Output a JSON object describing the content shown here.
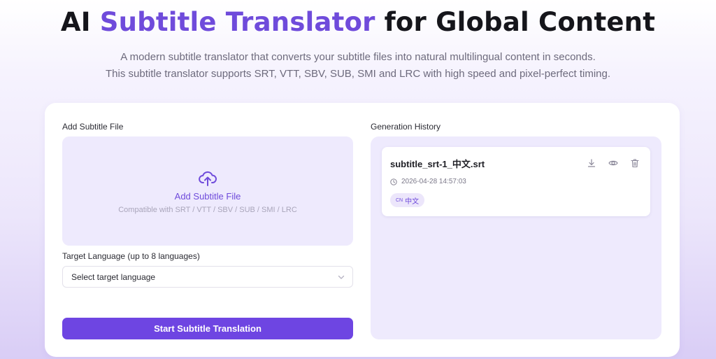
{
  "header": {
    "title_before": "AI ",
    "title_accent": "Subtitle Translator",
    "title_after": " for Global Content",
    "subtitle_line1": "A modern subtitle translator that converts your subtitle files into natural multilingual content in seconds.",
    "subtitle_line2": "This subtitle translator supports SRT, VTT, SBV, SUB, SMI and LRC with high speed and pixel-perfect timing."
  },
  "upload": {
    "section_label": "Add Subtitle File",
    "drop_title": "Add Subtitle File",
    "drop_hint": "Compatible with SRT / VTT / SBV / SUB / SMI / LRC",
    "icon": "cloud-upload-icon"
  },
  "language": {
    "label": "Target Language (up to 8 languages)",
    "placeholder": "Select target language"
  },
  "actions": {
    "start_label": "Start Subtitle Translation"
  },
  "history": {
    "label": "Generation History",
    "items": [
      {
        "file_name": "subtitle_srt-1_中文.srt",
        "timestamp": "2026-04-28 14:57:03",
        "badge_code": "CN",
        "badge_lang": "中文"
      }
    ]
  },
  "colors": {
    "accent": "#6f4bdb",
    "button": "#6e45e2",
    "panel": "#eeeafd"
  }
}
